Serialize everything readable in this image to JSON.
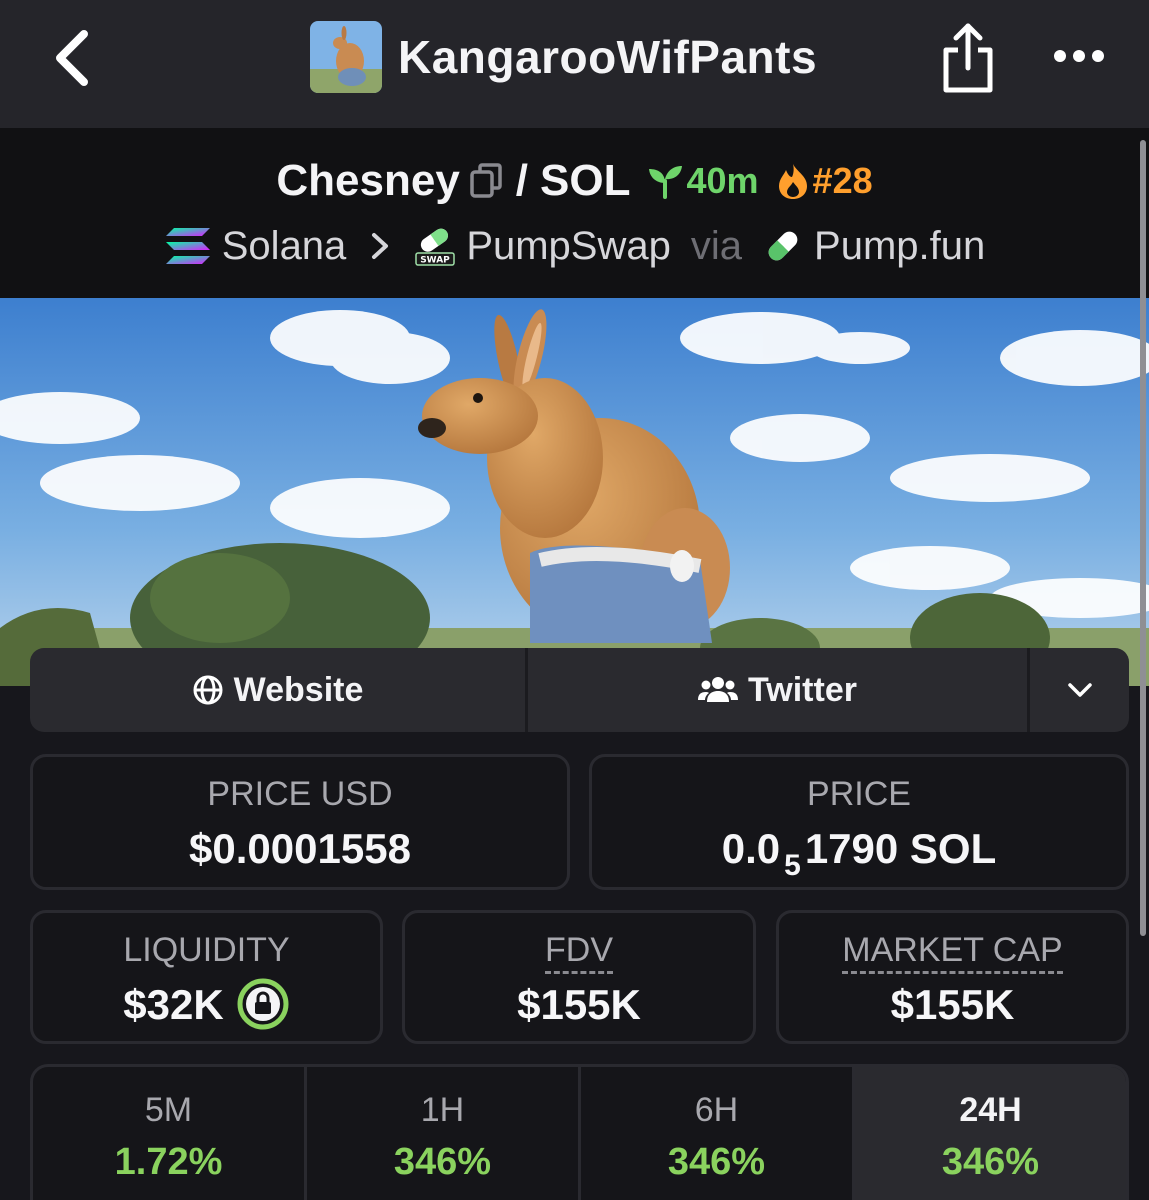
{
  "topbar": {
    "title": "KangarooWifPants"
  },
  "pair": {
    "base": "Chesney",
    "slash": "/",
    "quote": "SOL",
    "age": "40m",
    "rank": "#28"
  },
  "chain": {
    "network": "Solana",
    "dex": "PumpSwap",
    "via": "via",
    "launchpad": "Pump.fun"
  },
  "links": {
    "website": "Website",
    "twitter": "Twitter"
  },
  "stats": {
    "price_usd_label": "PRICE USD",
    "price_usd_value": "$0.0001558",
    "price_label": "PRICE",
    "price_prefix": "0.0",
    "price_zeros": "5",
    "price_suffix": "1790 SOL",
    "liquidity_label": "LIQUIDITY",
    "liquidity_value": "$32K",
    "fdv_label": "FDV",
    "fdv_value": "$155K",
    "mcap_label": "MARKET CAP",
    "mcap_value": "$155K"
  },
  "timeframes": [
    {
      "label": "5M",
      "value": "1.72%"
    },
    {
      "label": "1H",
      "value": "346%"
    },
    {
      "label": "6H",
      "value": "346%"
    },
    {
      "label": "24H",
      "value": "346%"
    }
  ],
  "colors": {
    "accent_green": "#6ed46a",
    "rank_orange": "#ff9f2d",
    "change_green": "#8ad25e",
    "background": "#17171c"
  }
}
